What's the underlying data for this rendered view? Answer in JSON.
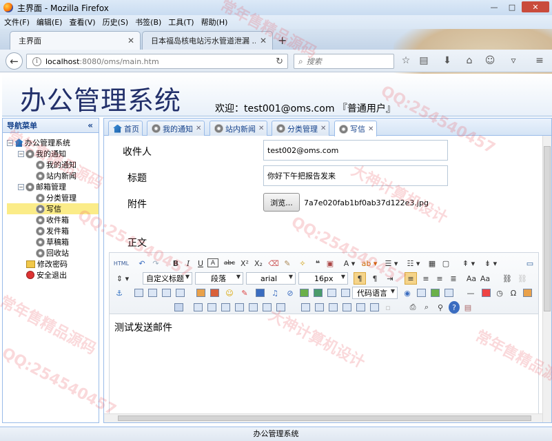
{
  "browser": {
    "window_title": "主界面 - Mozilla Firefox",
    "menu": [
      "文件(F)",
      "编辑(E)",
      "查看(V)",
      "历史(S)",
      "书签(B)",
      "工具(T)",
      "帮助(H)"
    ],
    "tabs": [
      {
        "label": "主界面",
        "active": true
      },
      {
        "label": "日本福岛核电站污水管道泄漏 ...",
        "active": false
      }
    ],
    "url_host": "localhost",
    "url_path": ":8080/oms/main.htm",
    "search_placeholder": "搜索"
  },
  "header": {
    "app_title": "办公管理系统",
    "welcome": "欢迎：test001@oms.com 『普通用户』"
  },
  "sidebar": {
    "title": "导航菜单",
    "collapse_glyph": "«",
    "tree": [
      {
        "label": "办公管理系统",
        "icon": "home-icon"
      },
      {
        "label": "我的通知",
        "icon": "gear-icon"
      },
      {
        "label": "我的通知",
        "icon": "gear-icon"
      },
      {
        "label": "站内新闻",
        "icon": "gear-icon"
      },
      {
        "label": "邮箱管理",
        "icon": "gear-icon"
      },
      {
        "label": "分类管理",
        "icon": "gear-icon"
      },
      {
        "label": "写信",
        "icon": "gear-icon",
        "selected": true
      },
      {
        "label": "收件箱",
        "icon": "gear-icon"
      },
      {
        "label": "发件箱",
        "icon": "gear-icon"
      },
      {
        "label": "草稿箱",
        "icon": "gear-icon"
      },
      {
        "label": "回收站",
        "icon": "gear-icon"
      },
      {
        "label": "修改密码",
        "icon": "folder-icon"
      },
      {
        "label": "安全退出",
        "icon": "exit-icon"
      }
    ]
  },
  "page_tabs": [
    {
      "label": "首页",
      "icon": "home-icon",
      "closable": false
    },
    {
      "label": "我的通知",
      "icon": "gear-icon",
      "closable": true
    },
    {
      "label": "站内新闻",
      "icon": "gear-icon",
      "closable": true
    },
    {
      "label": "分类管理",
      "icon": "gear-icon",
      "closable": true
    },
    {
      "label": "写信",
      "icon": "gear-icon",
      "closable": true,
      "active": true
    }
  ],
  "form": {
    "recipient_label": "收件人",
    "recipient_value": "test002@oms.com",
    "subject_label": "标题",
    "subject_value": "你好下午把报告发来",
    "attachment_label": "附件",
    "browse_label": "浏览...",
    "attachment_filename": "7a7e020fab1bf0ab37d122e3.jpg",
    "body_label": "正文",
    "body_text": "测试发送邮件"
  },
  "editor_toolbar": {
    "heading_select": "自定义标题",
    "paragraph_select": "段落",
    "font_select": "arial",
    "size_select": "16px",
    "code_select": "代码语言"
  },
  "footer": {
    "text": "办公管理系统"
  },
  "watermarks": [
    "常年售精品源码",
    "QQ:254540457",
    "大神计算机设计"
  ]
}
